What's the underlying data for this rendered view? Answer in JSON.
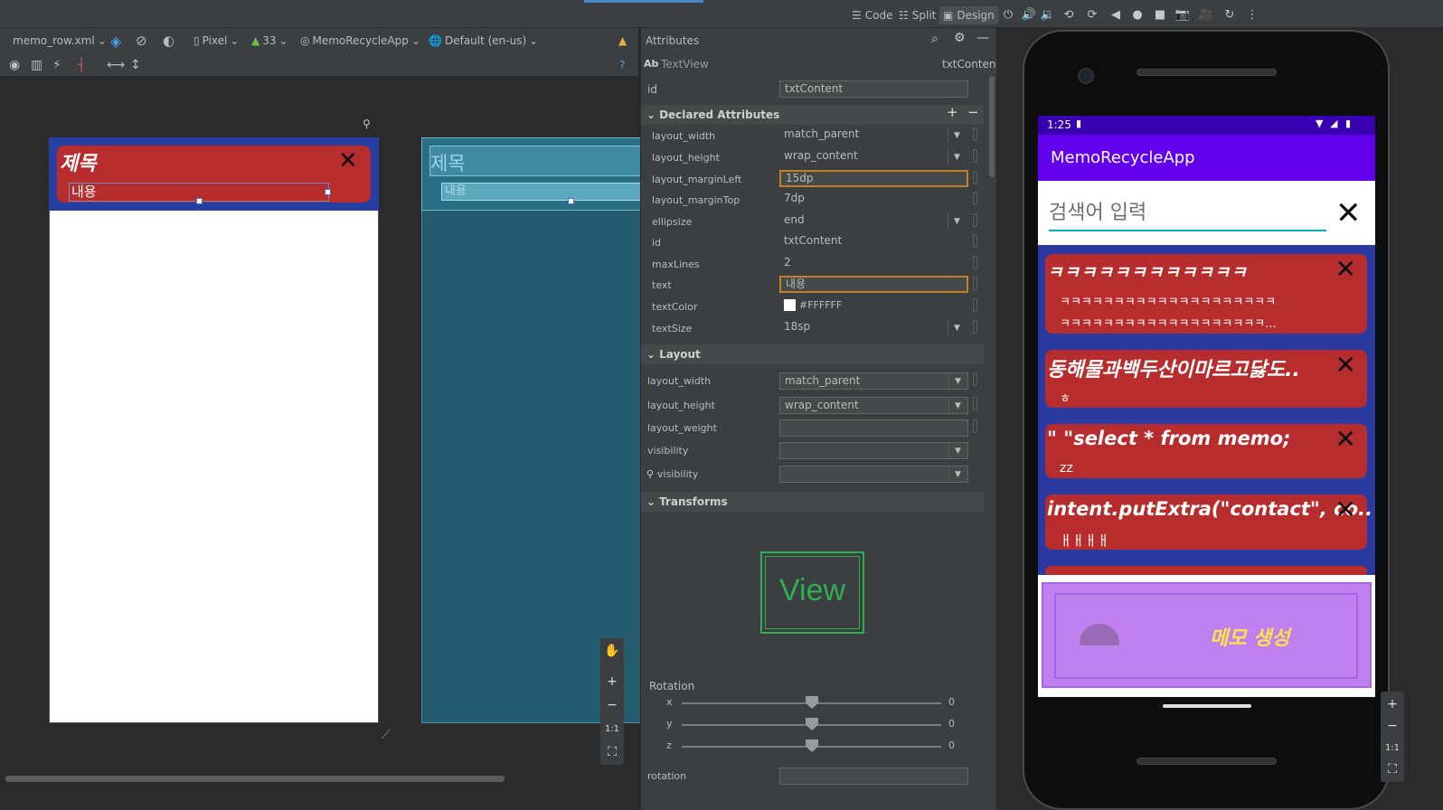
{
  "top_toolbar": {
    "code_label": "Code",
    "split_label": "Split",
    "design_label": "Design"
  },
  "editor_toolbar": {
    "file_name": "memo_row.xml",
    "device": "Pixel",
    "api_level": "33",
    "theme": "MemoRecycleApp",
    "locale": "Default (en-us)"
  },
  "design_preview": {
    "title_text": "제목",
    "content_text": "내용",
    "close_symbol": "✕"
  },
  "blueprint_preview": {
    "title_text": "제목",
    "content_text": "내용"
  },
  "zoom_panel": {
    "plus": "+",
    "minus": "−",
    "one_to_one": "1:1"
  },
  "attributes": {
    "panel_title": "Attributes",
    "view_type": "TextView",
    "view_id": "txtContent",
    "id_label": "id",
    "id_value": "txtContent",
    "declared_section": "Declared Attributes",
    "declared": [
      {
        "name": "layout_width",
        "value": "match_parent",
        "dropdown": true
      },
      {
        "name": "layout_height",
        "value": "wrap_content",
        "dropdown": true
      },
      {
        "name": "layout_marginLeft",
        "value": "15dp",
        "focused": true
      },
      {
        "name": "layout_marginTop",
        "value": "7dp"
      },
      {
        "name": "ellipsize",
        "value": "end",
        "dropdown": true
      },
      {
        "name": "id",
        "value": "txtContent"
      },
      {
        "name": "maxLines",
        "value": "2"
      },
      {
        "name": "text",
        "value": "내용",
        "focused": true
      },
      {
        "name": "textColor",
        "value": "#FFFFFF"
      },
      {
        "name": "textSize",
        "value": "18sp",
        "dropdown": true
      }
    ],
    "layout_section": "Layout",
    "layout": [
      {
        "name": "layout_width",
        "value": "match_parent"
      },
      {
        "name": "layout_height",
        "value": "wrap_content"
      },
      {
        "name": "layout_weight",
        "value": ""
      },
      {
        "name": "visibility",
        "value": ""
      },
      {
        "name": "visibility",
        "value": ""
      }
    ],
    "transforms_section": "Transforms",
    "view_preview_label": "View",
    "rotation_label": "Rotation",
    "rotation_axes": [
      {
        "axis": "x",
        "value": "0"
      },
      {
        "axis": "y",
        "value": "0"
      },
      {
        "axis": "z",
        "value": "0"
      }
    ],
    "rotation_field_label": "rotation"
  },
  "emulator": {
    "time": "1:25",
    "app_title": "MemoRecycleApp",
    "search_placeholder": "검색어 입력",
    "memos": [
      {
        "title": "ㅋㅋㅋㅋㅋㅋㅋㅋㅋㅋㅋㅋ",
        "content_line1": "ㅋㅋㅋㅋㅋㅋㅋㅋㅋㅋㅋㅋㅋㅋㅋㅋㅋㅋㅋㅋ",
        "content_line2": "ㅋㅋㅋㅋㅋㅋㅋㅋㅋㅋㅋㅋㅋㅋㅋㅋㅋㅋㅋ..."
      },
      {
        "title": "동해물과백두산이마르고닳도..",
        "content_line1": "ㅎ"
      },
      {
        "title": "\" \"select * from memo;",
        "content_line1": "zz"
      },
      {
        "title": "intent.putExtra(\"contact\", co..",
        "content_line1": "ㅐㅐㅐㅐ"
      }
    ],
    "fab_label": "메모 생성"
  },
  "colors": {
    "card_red": "#b72c2c",
    "app_purple": "#6200ee",
    "status_purple": "#3700b3",
    "fab_purple": "#bf80f0",
    "fab_text_yellow": "#ffe14a"
  }
}
